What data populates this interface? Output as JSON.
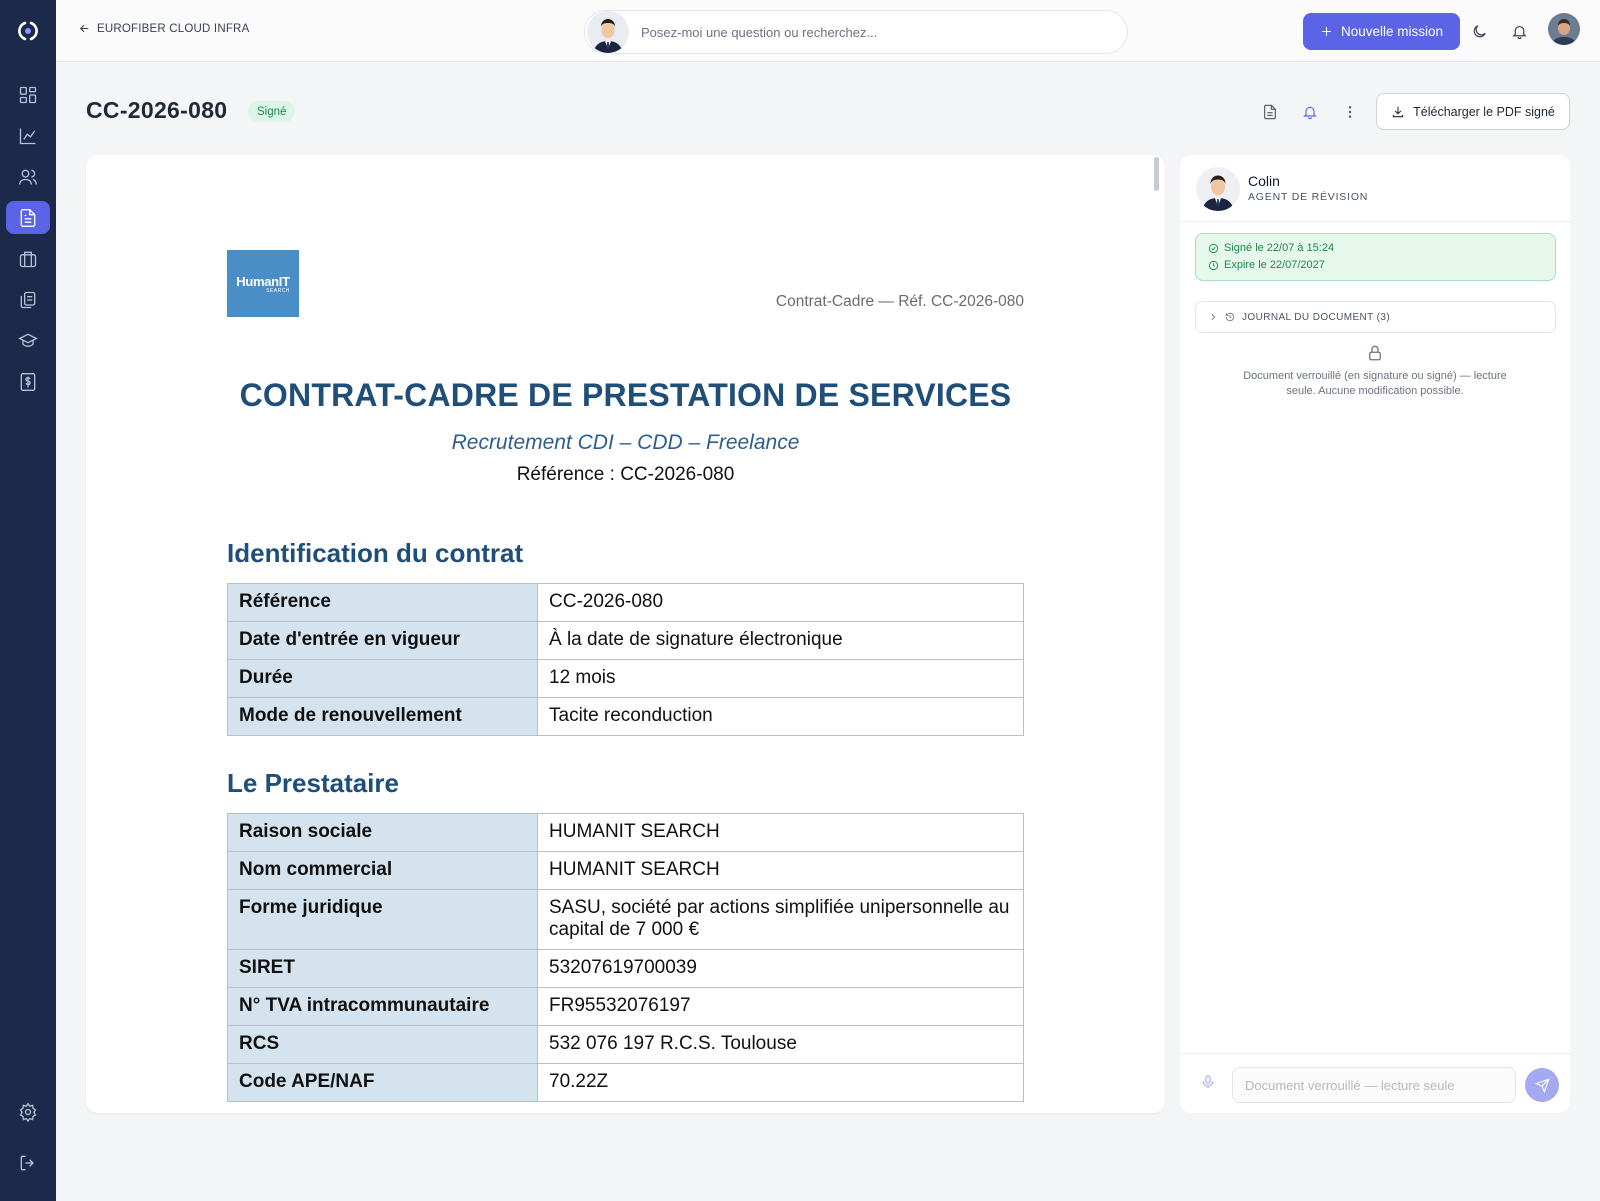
{
  "topbar": {
    "back_label": "EUROFIBER CLOUD INFRA",
    "search_placeholder": "Posez-moi une question ou recherchez...",
    "new_mission_label": "Nouvelle mission"
  },
  "sidebar": {
    "items": [
      {
        "name": "dashboard-icon",
        "active": false
      },
      {
        "name": "analytics-icon",
        "active": false
      },
      {
        "name": "users-icon",
        "active": false
      },
      {
        "name": "documents-icon",
        "active": true
      },
      {
        "name": "briefcase-icon",
        "active": false
      },
      {
        "name": "files-icon",
        "active": false
      },
      {
        "name": "graduation-cap-icon",
        "active": false
      },
      {
        "name": "billing-icon",
        "active": false
      }
    ],
    "bottom": [
      "settings-icon",
      "logout-icon"
    ]
  },
  "header": {
    "title": "CC-2026-080",
    "status": "Signé",
    "download_label": "Télécharger le PDF signé"
  },
  "document": {
    "logo_line1": "HumanIT",
    "logo_line2": "SEARCH",
    "header_ref": "Contrat-Cadre — Réf. CC-2026-080",
    "title": "CONTRAT-CADRE DE PRESTATION DE SERVICES",
    "subtitle": "Recrutement CDI – CDD – Freelance",
    "reference_line": "Référence : CC-2026-080",
    "section1_title": "Identification du contrat",
    "section1_rows": [
      {
        "k": "Référence",
        "v": "CC-2026-080"
      },
      {
        "k": "Date d'entrée en vigueur",
        "v": "À la date de signature électronique"
      },
      {
        "k": "Durée",
        "v": "12 mois"
      },
      {
        "k": "Mode de renouvellement",
        "v": "Tacite reconduction"
      }
    ],
    "section2_title": "Le Prestataire",
    "section2_rows": [
      {
        "k": "Raison sociale",
        "v": "HUMANIT SEARCH"
      },
      {
        "k": "Nom commercial",
        "v": "HUMANIT SEARCH"
      },
      {
        "k": "Forme juridique",
        "v": "SASU, société par actions simplifiée unipersonnelle au capital de 7 000 €"
      },
      {
        "k": "SIRET",
        "v": "53207619700039"
      },
      {
        "k": "N° TVA intracommunautaire",
        "v": "FR95532076197"
      },
      {
        "k": "RCS",
        "v": "532 076 197 R.C.S. Toulouse"
      },
      {
        "k": "Code APE/NAF",
        "v": "70.22Z"
      }
    ]
  },
  "agent": {
    "name": "Colin",
    "role": "AGENT DE RÉVISION",
    "signed_on": "Signé le 22/07 à 15:24",
    "expires_on": "Expire le 22/07/2027",
    "journal_label": "JOURNAL DU DOCUMENT (3)",
    "lock_message": "Document verrouillé (en signature ou signé) — lecture seule. Aucune modification possible.",
    "input_placeholder": "Document verrouillé — lecture seule"
  },
  "colors": {
    "accent": "#5b63e6",
    "sidebar_bg": "#1b2a4a",
    "doc_heading": "#1f4e79",
    "table_key_bg": "#d4e3ee",
    "success": "#1f8a4c"
  }
}
